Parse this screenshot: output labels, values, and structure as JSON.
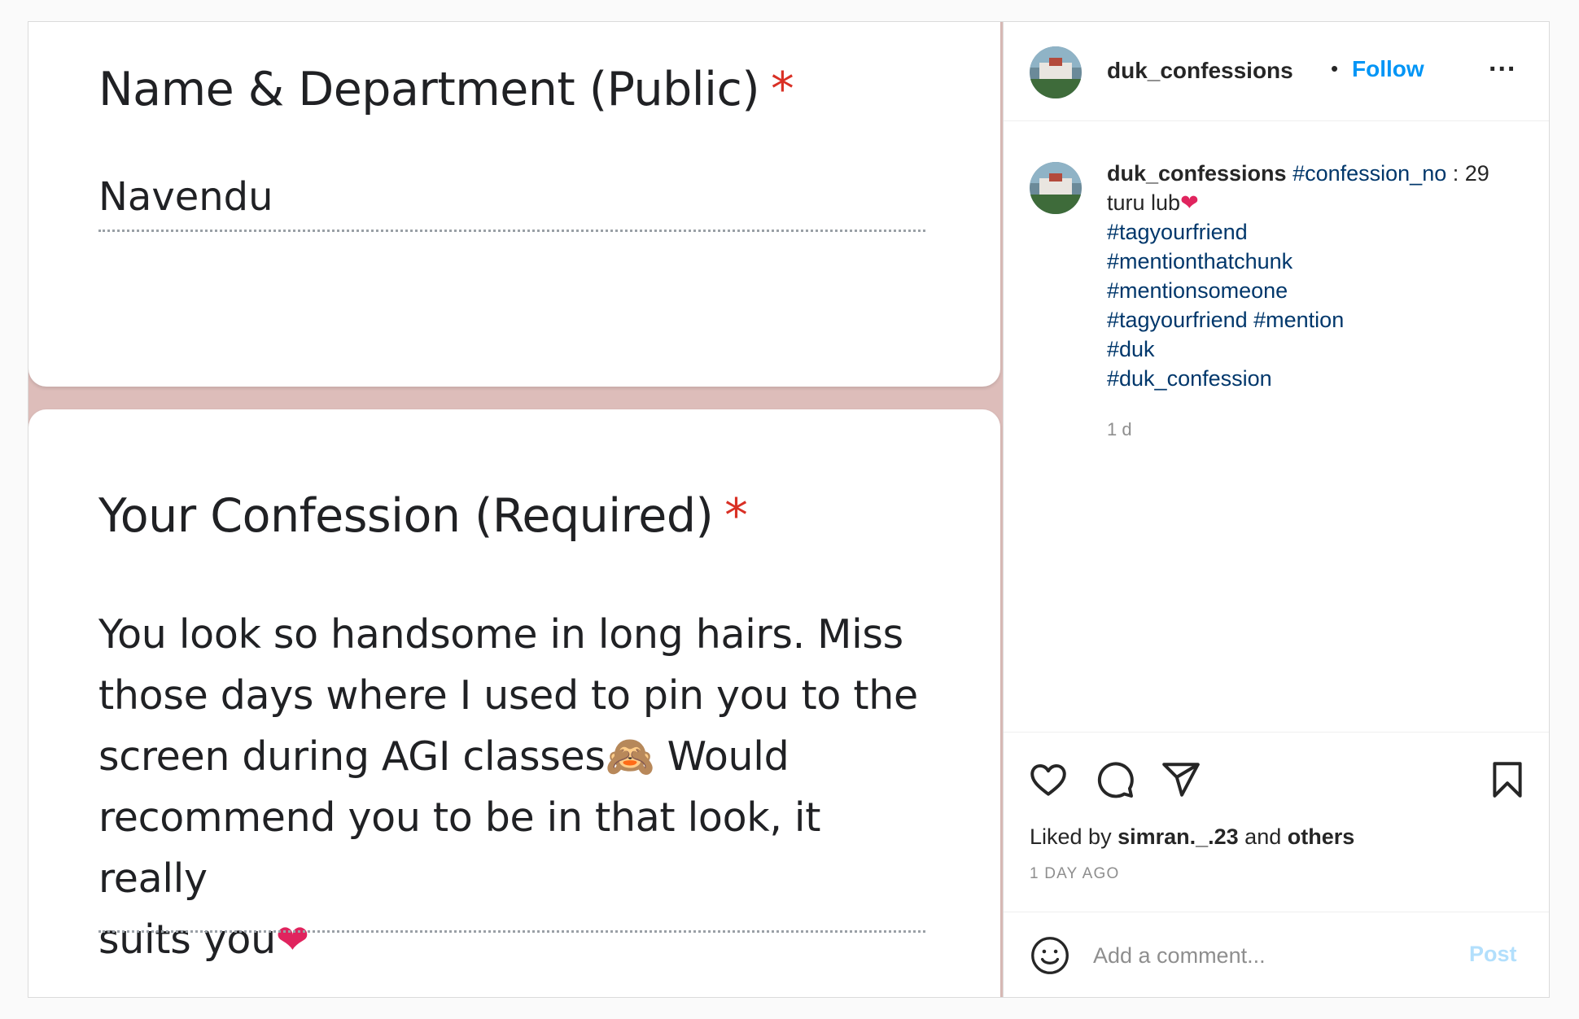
{
  "form": {
    "question_1": {
      "title": "Name & Department (Public)",
      "required_mark": "*",
      "answer": "Navendu"
    },
    "question_2": {
      "title": "Your Confession (Required)",
      "required_mark": "*",
      "answer_lines": [
        "You look so handsome in long hairs. Miss",
        "those days where I used to pin you to the",
        "screen during AGI classes",
        "Would",
        "recommend you to be in that look, it really",
        "suits you"
      ],
      "emoji_see_no_evil": "🙈",
      "emoji_heart": "❤"
    }
  },
  "post": {
    "username": "duk_confessions",
    "separator": "•",
    "follow_label": "Follow",
    "more_label": "...",
    "caption": {
      "username": "duk_confessions",
      "first_tag": "#confession_no",
      "first_tail": " : 29",
      "line_2": "turu lub",
      "heart": "❤",
      "tags": [
        "#tagyourfriend",
        "#mentionthatchunk",
        "#mentionsomeone",
        "#tagyourfriend",
        "#mention",
        "#duk",
        "#duk_confession"
      ]
    },
    "time_short": "1 d",
    "likes": {
      "prefix": "Liked by ",
      "user": "simran._.23",
      "middle": " and ",
      "others": "others"
    },
    "time_long": "1 DAY AGO",
    "comment_placeholder": "Add a comment...",
    "post_label": "Post",
    "colors": {
      "link": "#0095f6",
      "hashtag": "#00376b",
      "media_bg": "#ddbdba",
      "required": "#d93025"
    }
  },
  "icons": [
    "heart-icon",
    "comment-icon",
    "share-icon",
    "bookmark-icon",
    "emoji-icon",
    "more-icon"
  ]
}
